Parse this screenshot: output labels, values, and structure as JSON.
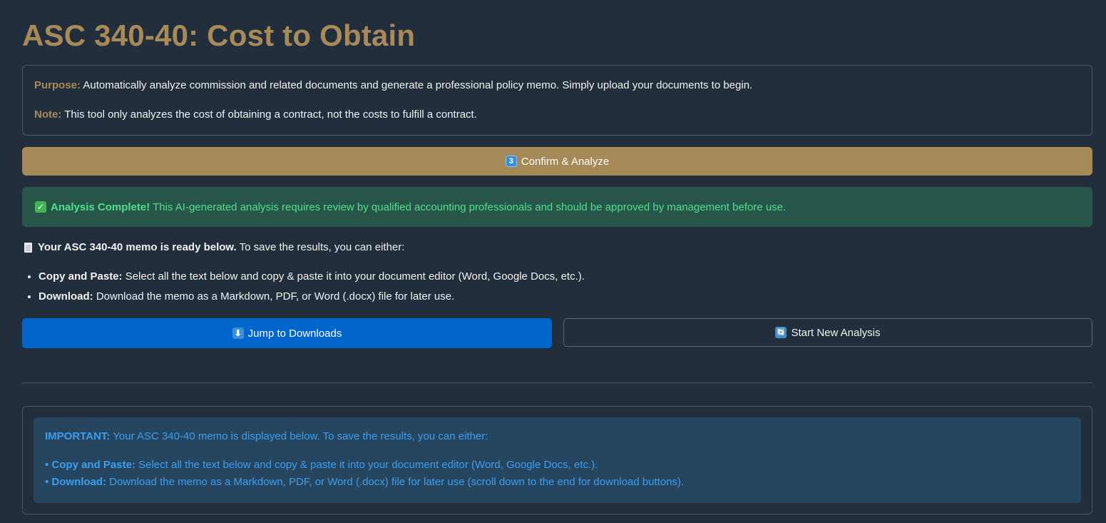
{
  "header": {
    "title": "ASC 340-40: Cost to Obtain"
  },
  "purpose_box": {
    "purpose_label": "Purpose:",
    "purpose_text": "Automatically analyze commission and related documents and generate a professional policy memo. Simply upload your documents to begin.",
    "note_label": "Note:",
    "note_text": "This tool only analyzes the cost of obtaining a contract, not the costs to fulfill a contract."
  },
  "confirm": {
    "icon_glyph": "3",
    "label": "Confirm & Analyze"
  },
  "success": {
    "icon": "check-mark-icon",
    "bold": "Analysis Complete!",
    "text": "This AI-generated analysis requires review by qualified accounting professionals and should be approved by management before use."
  },
  "ready": {
    "icon": "page-icon",
    "bold": "Your ASC 340-40 memo is ready below.",
    "text": "To save the results, you can either:"
  },
  "options": [
    {
      "bold": "Copy and Paste:",
      "text": "Select all the text below and copy & paste it into your document editor (Word, Google Docs, etc.)."
    },
    {
      "bold": "Download:",
      "text": "Download the memo as a Markdown, PDF, or Word (.docx) file for later use."
    }
  ],
  "buttons": {
    "jump_icon_glyph": "⬇",
    "jump_label": "Jump to Downloads",
    "new_icon_glyph": "🔄",
    "new_label": "Start New Analysis"
  },
  "memo_notice": {
    "lead_bold": "IMPORTANT:",
    "lead_text": "Your ASC 340-40 memo is displayed below. To save the results, you can either:",
    "bullet1_bold": "• Copy and Paste:",
    "bullet1_text": "Select all the text below and copy & paste it into your document editor (Word, Google Docs, etc.).",
    "bullet2_bold": "• Download:",
    "bullet2_text": "Download the memo as a Markdown, PDF, or Word (.docx) file for later use (scroll down to the end for download buttons)."
  },
  "colors": {
    "background": "#222e3c",
    "accent_gold": "#a88a58",
    "success_bg": "#27554a",
    "success_text": "#4fe08a",
    "primary_button": "#0066cc",
    "info_bg": "#26455f",
    "info_text": "#3c9ef0"
  }
}
